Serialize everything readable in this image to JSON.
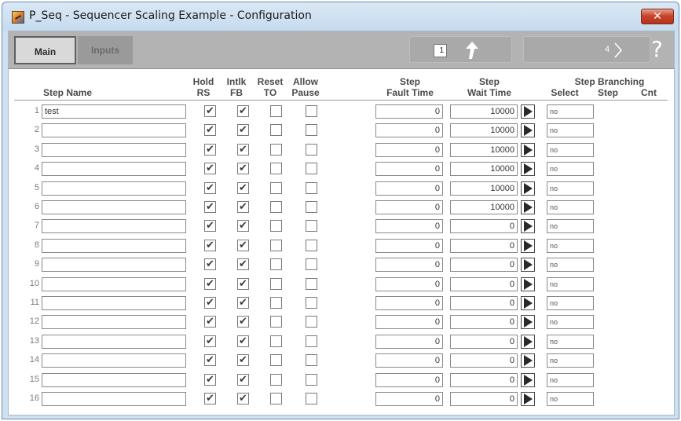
{
  "window": {
    "title": "P_Seq - Sequencer Scaling Example - Configuration",
    "close_glyph": "✕"
  },
  "toolbar": {
    "tabs": [
      {
        "label": "Main",
        "active": true
      },
      {
        "label": "Inputs",
        "active": false
      }
    ],
    "page_value": "1",
    "page_count": "4",
    "next_glyph": "〉",
    "help_glyph": "?",
    "icons": {
      "up": "up-arrow-icon",
      "next": "chevron-right-icon",
      "help": "help-icon"
    }
  },
  "headers": {
    "step_name": "Step Name",
    "hold_1": "Hold",
    "hold_2": "RS",
    "intlk_1": "Intlk",
    "intlk_2": "FB",
    "reset_1": "Reset",
    "reset_2": "TO",
    "allow_1": "Allow",
    "allow_2": "Pause",
    "fault_1": "Step",
    "fault_2": "Fault Time",
    "wait_1": "Step",
    "wait_2": "Wait Time",
    "branching": "Step Branching",
    "select": "Select",
    "step": "Step",
    "cnt": "Cnt"
  },
  "rows": [
    {
      "num": "1",
      "name": "test",
      "hold_rs": true,
      "intlk_fb": true,
      "reset_to": false,
      "allow_pause": false,
      "fault_time": "0",
      "wait_time": "10000",
      "select": "no"
    },
    {
      "num": "2",
      "name": "",
      "hold_rs": true,
      "intlk_fb": true,
      "reset_to": false,
      "allow_pause": false,
      "fault_time": "0",
      "wait_time": "10000",
      "select": "no"
    },
    {
      "num": "3",
      "name": "",
      "hold_rs": true,
      "intlk_fb": true,
      "reset_to": false,
      "allow_pause": false,
      "fault_time": "0",
      "wait_time": "10000",
      "select": "no"
    },
    {
      "num": "4",
      "name": "",
      "hold_rs": true,
      "intlk_fb": true,
      "reset_to": false,
      "allow_pause": false,
      "fault_time": "0",
      "wait_time": "10000",
      "select": "no"
    },
    {
      "num": "5",
      "name": "",
      "hold_rs": true,
      "intlk_fb": true,
      "reset_to": false,
      "allow_pause": false,
      "fault_time": "0",
      "wait_time": "10000",
      "select": "no"
    },
    {
      "num": "6",
      "name": "",
      "hold_rs": true,
      "intlk_fb": true,
      "reset_to": false,
      "allow_pause": false,
      "fault_time": "0",
      "wait_time": "10000",
      "select": "no"
    },
    {
      "num": "7",
      "name": "",
      "hold_rs": true,
      "intlk_fb": true,
      "reset_to": false,
      "allow_pause": false,
      "fault_time": "0",
      "wait_time": "0",
      "select": "no"
    },
    {
      "num": "8",
      "name": "",
      "hold_rs": true,
      "intlk_fb": true,
      "reset_to": false,
      "allow_pause": false,
      "fault_time": "0",
      "wait_time": "0",
      "select": "no"
    },
    {
      "num": "9",
      "name": "",
      "hold_rs": true,
      "intlk_fb": true,
      "reset_to": false,
      "allow_pause": false,
      "fault_time": "0",
      "wait_time": "0",
      "select": "no"
    },
    {
      "num": "10",
      "name": "",
      "hold_rs": true,
      "intlk_fb": true,
      "reset_to": false,
      "allow_pause": false,
      "fault_time": "0",
      "wait_time": "0",
      "select": "no"
    },
    {
      "num": "11",
      "name": "",
      "hold_rs": true,
      "intlk_fb": true,
      "reset_to": false,
      "allow_pause": false,
      "fault_time": "0",
      "wait_time": "0",
      "select": "no"
    },
    {
      "num": "12",
      "name": "",
      "hold_rs": true,
      "intlk_fb": true,
      "reset_to": false,
      "allow_pause": false,
      "fault_time": "0",
      "wait_time": "0",
      "select": "no"
    },
    {
      "num": "13",
      "name": "",
      "hold_rs": true,
      "intlk_fb": true,
      "reset_to": false,
      "allow_pause": false,
      "fault_time": "0",
      "wait_time": "0",
      "select": "no"
    },
    {
      "num": "14",
      "name": "",
      "hold_rs": true,
      "intlk_fb": true,
      "reset_to": false,
      "allow_pause": false,
      "fault_time": "0",
      "wait_time": "0",
      "select": "no"
    },
    {
      "num": "15",
      "name": "",
      "hold_rs": true,
      "intlk_fb": true,
      "reset_to": false,
      "allow_pause": false,
      "fault_time": "0",
      "wait_time": "0",
      "select": "no"
    },
    {
      "num": "16",
      "name": "",
      "hold_rs": true,
      "intlk_fb": true,
      "reset_to": false,
      "allow_pause": false,
      "fault_time": "0",
      "wait_time": "0",
      "select": "no"
    }
  ],
  "check_glyph": "✔",
  "colors": {
    "title_bg": "#c6dbef",
    "toolbar_bg": "#b3b3b3",
    "close_btn": "#c8452c"
  }
}
